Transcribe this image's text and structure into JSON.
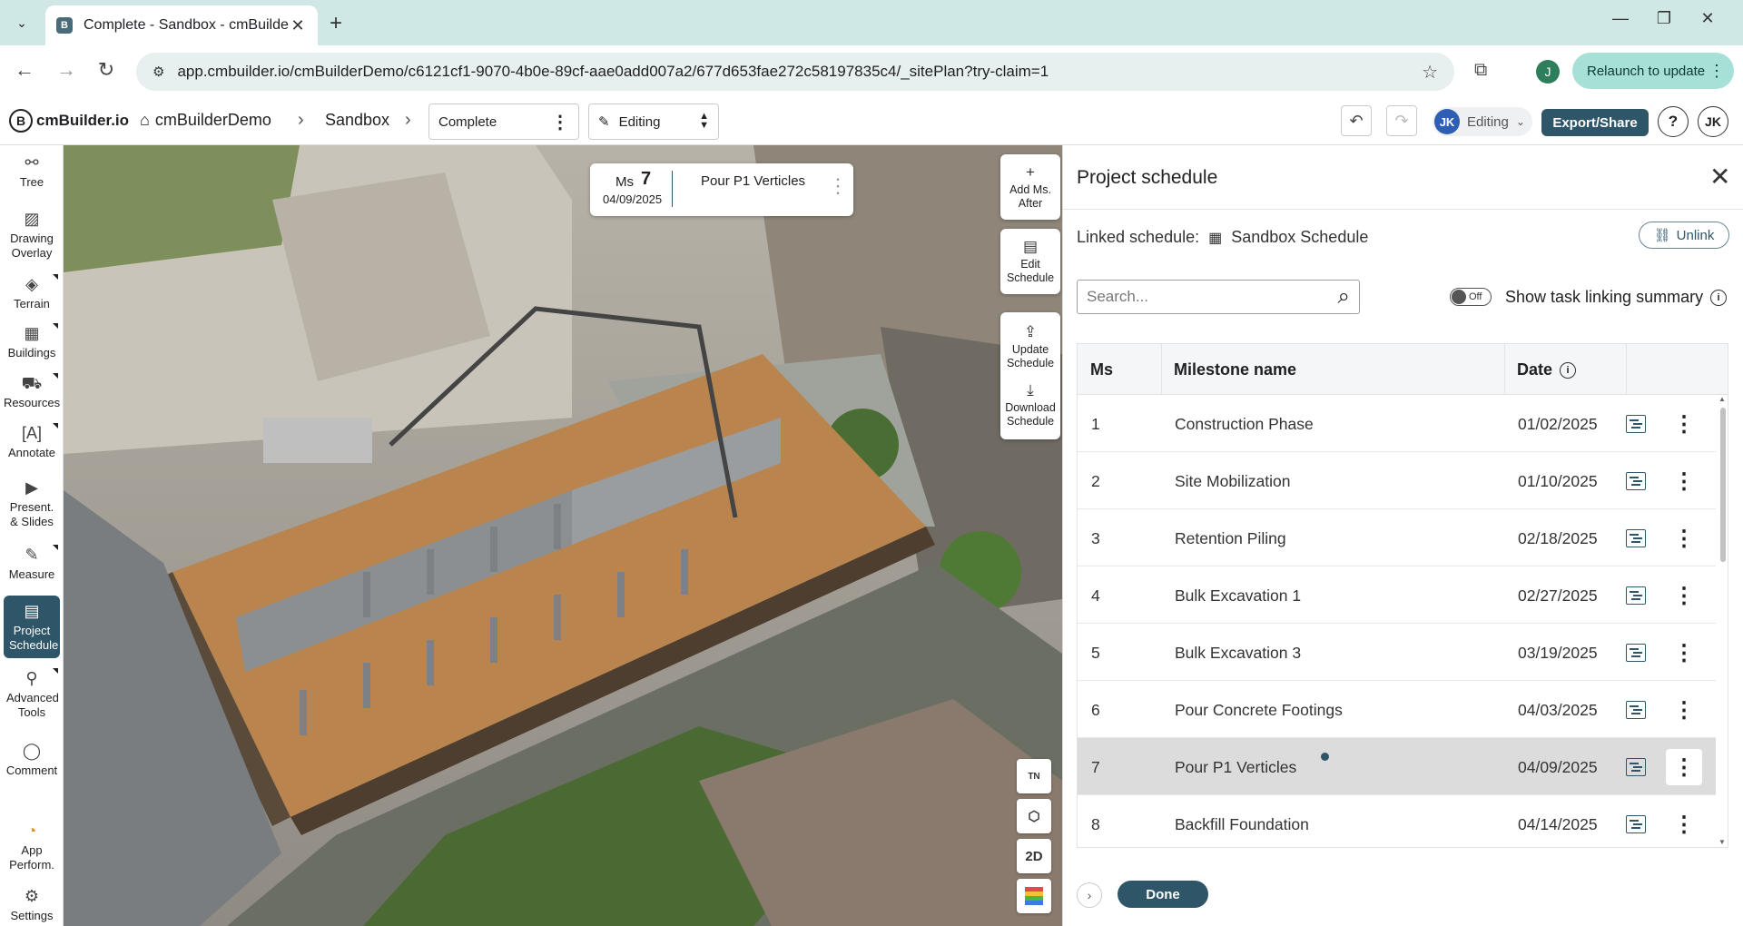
{
  "browser": {
    "tab_title": "Complete - Sandbox - cmBuilder",
    "favicon_letter": "B",
    "url": "app.cmbuilder.io/cmBuilderDemo/c6121cf1-9070-4b0e-89cf-aae0add007a2/677d653fae272c58197835c4/_sitePlan?try-claim=1",
    "profile_initial": "J",
    "relaunch_label": "Relaunch to update"
  },
  "header": {
    "logo_text": "cmBuilder.io",
    "breadcrumb_home": "cmBuilderDemo",
    "breadcrumb_project": "Sandbox",
    "view_name": "Complete",
    "mode": "Editing",
    "user_initials": "JK",
    "user_mode": "Editing",
    "export_label": "Export/Share",
    "help_label": "?",
    "account_initials": "JK"
  },
  "tools": [
    {
      "label": "Tree",
      "icon": "tree-icon"
    },
    {
      "label": "Drawing Overlay",
      "icon": "image-icon"
    },
    {
      "label": "Terrain",
      "icon": "terrain-icon"
    },
    {
      "label": "Buildings",
      "icon": "buildings-icon"
    },
    {
      "label": "Resources",
      "icon": "resources-icon"
    },
    {
      "label": "Annotate",
      "icon": "annotate-icon"
    },
    {
      "label": "Present. & Slides",
      "icon": "present-icon"
    },
    {
      "label": "Measure",
      "icon": "ruler-icon"
    },
    {
      "label": "Project Schedule",
      "icon": "schedule-icon"
    },
    {
      "label": "Advanced Tools",
      "icon": "advanced-icon"
    },
    {
      "label": "Comment",
      "icon": "comment-icon"
    },
    {
      "label": "App Perform.",
      "icon": "performance-icon"
    },
    {
      "label": "Settings",
      "icon": "gear-icon"
    }
  ],
  "viewport": {
    "ms_label": "Ms",
    "ms_number": "7",
    "ms_date": "04/09/2025",
    "ms_name": "Pour P1 Verticles",
    "add_ms_after": "Add Ms. After",
    "edit_schedule": "Edit Schedule",
    "update_schedule": "Update Schedule",
    "download_schedule": "Download Schedule",
    "true_north": "TN",
    "view_2d": "2D"
  },
  "panel": {
    "title": "Project schedule",
    "linked_label": "Linked schedule:",
    "linked_name": "Sandbox Schedule",
    "unlink_label": "Unlink",
    "search_placeholder": "Search...",
    "toggle_state": "Off",
    "toggle_label": "Show task linking summary",
    "columns": {
      "ms": "Ms",
      "name": "Milestone name",
      "date": "Date"
    },
    "rows": [
      {
        "ms": "1",
        "name": "Construction Phase",
        "date": "01/02/2025"
      },
      {
        "ms": "2",
        "name": "Site Mobilization",
        "date": "01/10/2025"
      },
      {
        "ms": "3",
        "name": "Retention Piling",
        "date": "02/18/2025"
      },
      {
        "ms": "4",
        "name": "Bulk Excavation 1",
        "date": "02/27/2025"
      },
      {
        "ms": "5",
        "name": "Bulk Excavation 3",
        "date": "03/19/2025"
      },
      {
        "ms": "6",
        "name": "Pour Concrete Footings",
        "date": "04/03/2025"
      },
      {
        "ms": "7",
        "name": "Pour P1 Verticles",
        "date": "04/09/2025"
      },
      {
        "ms": "8",
        "name": "Backfill Foundation",
        "date": "04/14/2025"
      }
    ],
    "selected_row": "7",
    "done_label": "Done"
  }
}
